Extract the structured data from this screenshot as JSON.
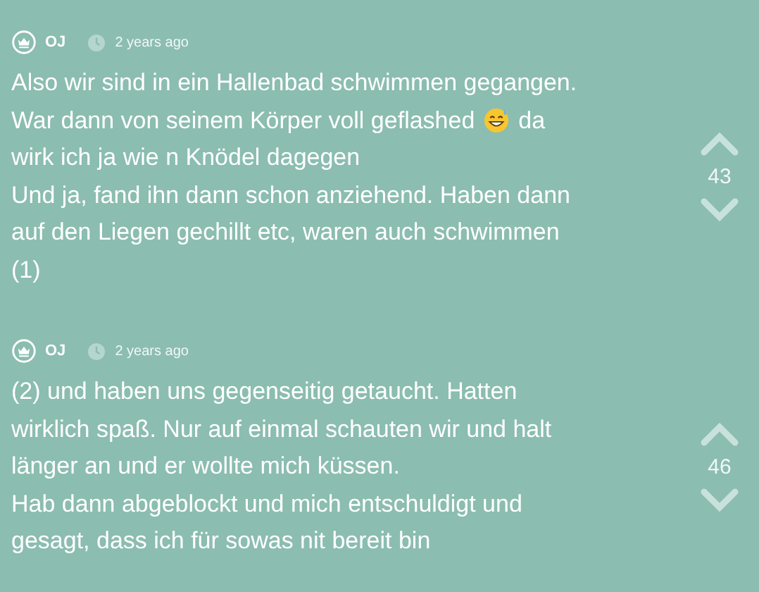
{
  "comments": [
    {
      "author": "OJ",
      "time": "2 years ago",
      "votes": "43",
      "lines": [
        {
          "kind": "text",
          "text": "Also wir sind in ein Hallenbad schwimmen gegangen."
        },
        {
          "kind": "emoji",
          "text": "War dann von seinem Körper voll geflashed",
          "after": "da"
        },
        {
          "kind": "text",
          "text": "wirk ich ja wie n Knödel dagegen"
        },
        {
          "kind": "text",
          "text": "Und ja, fand ihn dann schon anziehend. Haben dann"
        },
        {
          "kind": "text",
          "text": "auf den Liegen gechillt etc, waren auch schwimmen"
        },
        {
          "kind": "text",
          "text": "(1)"
        }
      ]
    },
    {
      "author": "OJ",
      "time": "2 years ago",
      "votes": "46",
      "lines": [
        {
          "kind": "text",
          "text": "(2) und haben uns gegenseitig getaucht. Hatten"
        },
        {
          "kind": "text",
          "text": "wirklich spaß. Nur auf einmal schauten wir und halt"
        },
        {
          "kind": "text",
          "text": "länger an und er wollte mich küssen."
        },
        {
          "kind": "text",
          "text": "Hab dann abgeblockt und mich entschuldigt und"
        },
        {
          "kind": "text",
          "text": "gesagt, dass ich für sowas nit bereit bin"
        }
      ]
    }
  ]
}
